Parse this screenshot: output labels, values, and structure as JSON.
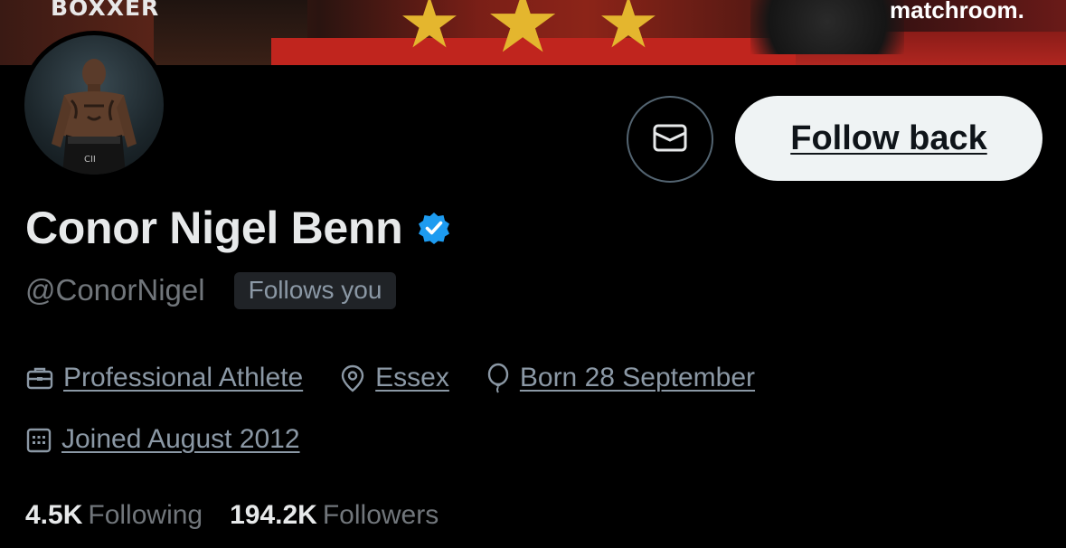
{
  "banner": {
    "left_watermark": "BOXXER",
    "right_watermark": "matchroom."
  },
  "profile": {
    "display_name": "Conor Nigel Benn",
    "verified": true,
    "handle": "@ConorNigel",
    "follows_you_badge": "Follows you"
  },
  "actions": {
    "message_icon": "envelope-icon",
    "follow_back_label": "Follow back"
  },
  "meta": {
    "category": {
      "icon": "briefcase-icon",
      "text": "Professional Athlete"
    },
    "location": {
      "icon": "location-pin-icon",
      "text": "Essex"
    },
    "birthday": {
      "icon": "balloon-icon",
      "text": "Born 28 September"
    },
    "joined": {
      "icon": "calendar-icon",
      "text": "Joined August 2012"
    }
  },
  "stats": {
    "following_count": "4.5K",
    "following_label": "Following",
    "followers_count": "194.2K",
    "followers_label": "Followers"
  },
  "colors": {
    "background": "#000000",
    "primary_text": "#e7e9ea",
    "secondary_text": "#71767b",
    "verified_blue": "#1d9bf0",
    "follow_button_bg": "#eff3f4"
  }
}
